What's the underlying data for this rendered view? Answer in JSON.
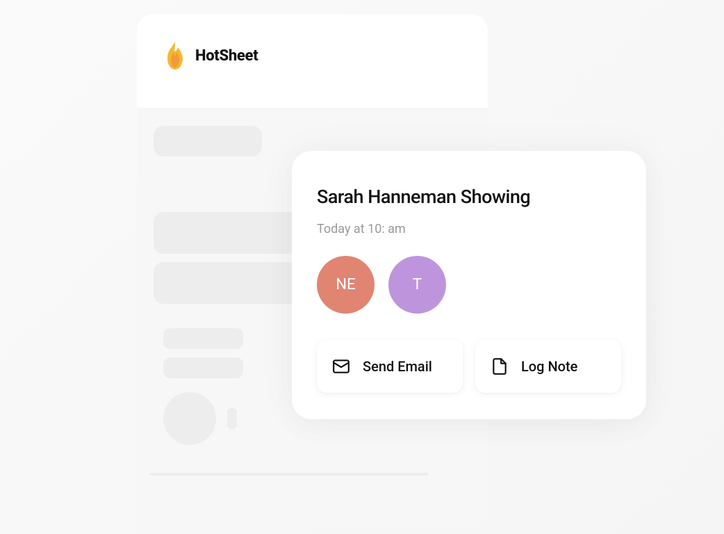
{
  "app": {
    "title": "HotSheet"
  },
  "detail": {
    "title": "Sarah Hanneman Showing",
    "time": "Today at 10: am",
    "avatars": [
      {
        "initials": "NE",
        "bg": "#e08572"
      },
      {
        "initials": "T",
        "bg": "#be95dd"
      }
    ],
    "actions": {
      "send_email_label": "Send Email",
      "log_note_label": "Log Note"
    }
  }
}
